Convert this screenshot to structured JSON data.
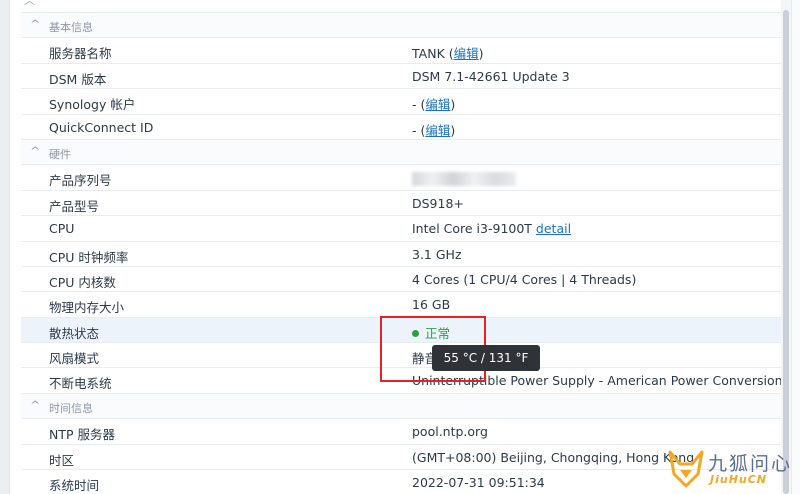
{
  "sections": [
    {
      "title": "基本信息",
      "rows": [
        {
          "label": "服务器名称",
          "value": "TANK",
          "link": "编辑"
        },
        {
          "label": "DSM 版本",
          "value": "DSM 7.1-42661 Update 3"
        },
        {
          "label": "Synology 帐户",
          "value": "-",
          "link": "编辑"
        },
        {
          "label": "QuickConnect ID",
          "value": "-",
          "link": "编辑"
        }
      ]
    },
    {
      "title": "硬件",
      "rows": [
        {
          "label": "产品序列号",
          "value": ""
        },
        {
          "label": "产品型号",
          "value": "DS918+"
        },
        {
          "label": "CPU",
          "value": "Intel Core i3-9100T",
          "link": "detail"
        },
        {
          "label": "CPU 时钟频率",
          "value": "3.1 GHz"
        },
        {
          "label": "CPU 内核数",
          "value": "4 Cores (1 CPU/4 Cores | 4 Threads)"
        },
        {
          "label": "物理内存大小",
          "value": "16 GB"
        },
        {
          "label": "散热状态",
          "value": "正常"
        },
        {
          "label": "风扇模式",
          "value": "静音"
        },
        {
          "label": "不断电系统",
          "value": "Uninterruptible Power Supply - American Power Conversion"
        }
      ]
    },
    {
      "title": "时间信息",
      "rows": [
        {
          "label": "NTP 服务器",
          "value": "pool.ntp.org"
        },
        {
          "label": "时区",
          "value": "(GMT+08:00) Beijing, Chongqing, Hong Kong"
        },
        {
          "label": "系统时间",
          "value": "2022-07-31 09:51:34"
        }
      ]
    }
  ],
  "tooltip": "55 °C / 131 °F",
  "watermark": {
    "cn": "九狐问心",
    "en": "JiuHuCN"
  },
  "colors": {
    "link": "#1a73c9",
    "status_ok": "#2ea043",
    "highlight_row": "#edf3fb",
    "annotation": "#e02424"
  },
  "icons": [
    "chevron-up-icon",
    "status-dot-icon",
    "fox-logo-icon"
  ]
}
